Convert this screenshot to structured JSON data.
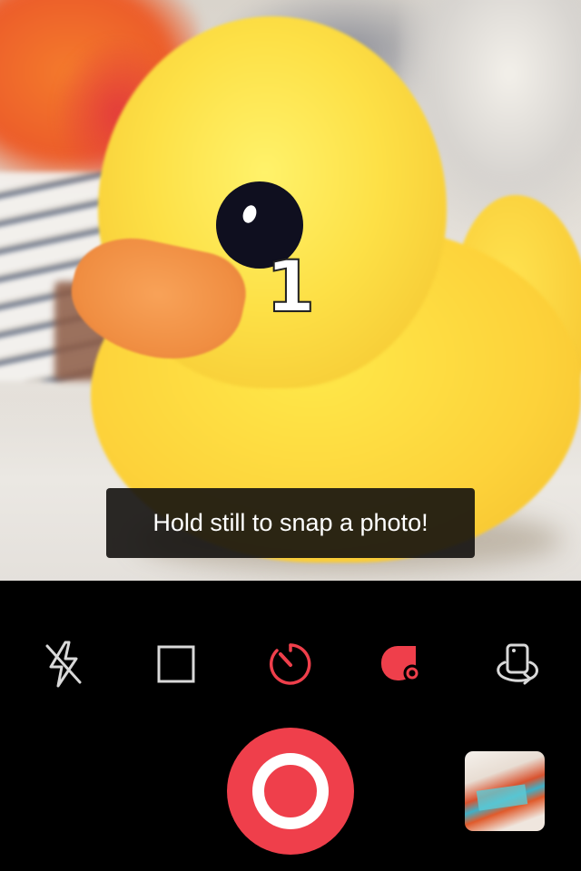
{
  "camera": {
    "countdown": "1",
    "hint": "Hold still to snap a photo!"
  },
  "toolbar": {
    "tools": [
      {
        "icon": "flash-off-icon",
        "active": false
      },
      {
        "icon": "square-crop-icon",
        "active": false
      },
      {
        "icon": "timer-icon",
        "active": true
      },
      {
        "icon": "hold-still-mode-icon",
        "active": true
      },
      {
        "icon": "switch-camera-icon",
        "active": false
      }
    ],
    "shutter_icon": "shutter-icon",
    "last_photo_icon": "last-photo-thumbnail"
  },
  "colors": {
    "accent": "#ef3f4b",
    "icon_inactive": "#d9d9d9",
    "toolbar_bg": "#000000",
    "hint_bg": "#141210"
  }
}
